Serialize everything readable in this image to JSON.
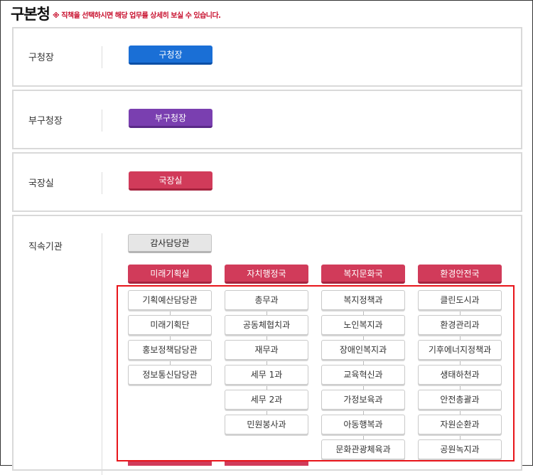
{
  "page": {
    "title": "구본청",
    "notice": "※ 직책을 선택하시면 해당 업무를 상세히 보실 수 있습니다."
  },
  "rows": {
    "mayor": {
      "label": "구청장",
      "button": "구청장"
    },
    "vice_mayor": {
      "label": "부구청장",
      "button": "부구청장"
    },
    "director": {
      "label": "국장실",
      "button": "국장실"
    },
    "direct": {
      "label": "직속기관",
      "audit_button": "감사담당관"
    }
  },
  "columns": [
    {
      "head": "미래기획실",
      "items": [
        "기획예산담당관",
        "미래기획단",
        "홍보정책담당관",
        "정보통신담당관"
      ]
    },
    {
      "head": "자치행정국",
      "items": [
        "총무과",
        "공동체협치과",
        "재무과",
        "세무 1과",
        "세무 2과",
        "민원봉사과"
      ]
    },
    {
      "head": "복지문화국",
      "items": [
        "복지정책과",
        "노인복지과",
        "장애인복지과",
        "교육혁신과",
        "가정보육과",
        "아동행복과",
        "문화관광체육과"
      ]
    },
    {
      "head": "환경안전국",
      "items": [
        "클린도시과",
        "환경관리과",
        "기후에너지정책과",
        "생태하천과",
        "안전총괄과",
        "자원순환과",
        "공원녹지과"
      ]
    }
  ],
  "colors": {
    "blue": "#1a6fd6",
    "purple": "#7a3fb0",
    "red": "#d13b5a",
    "gray": "#e6e6e6",
    "highlight_border": "#e8141a",
    "notice": "#c8102e"
  }
}
